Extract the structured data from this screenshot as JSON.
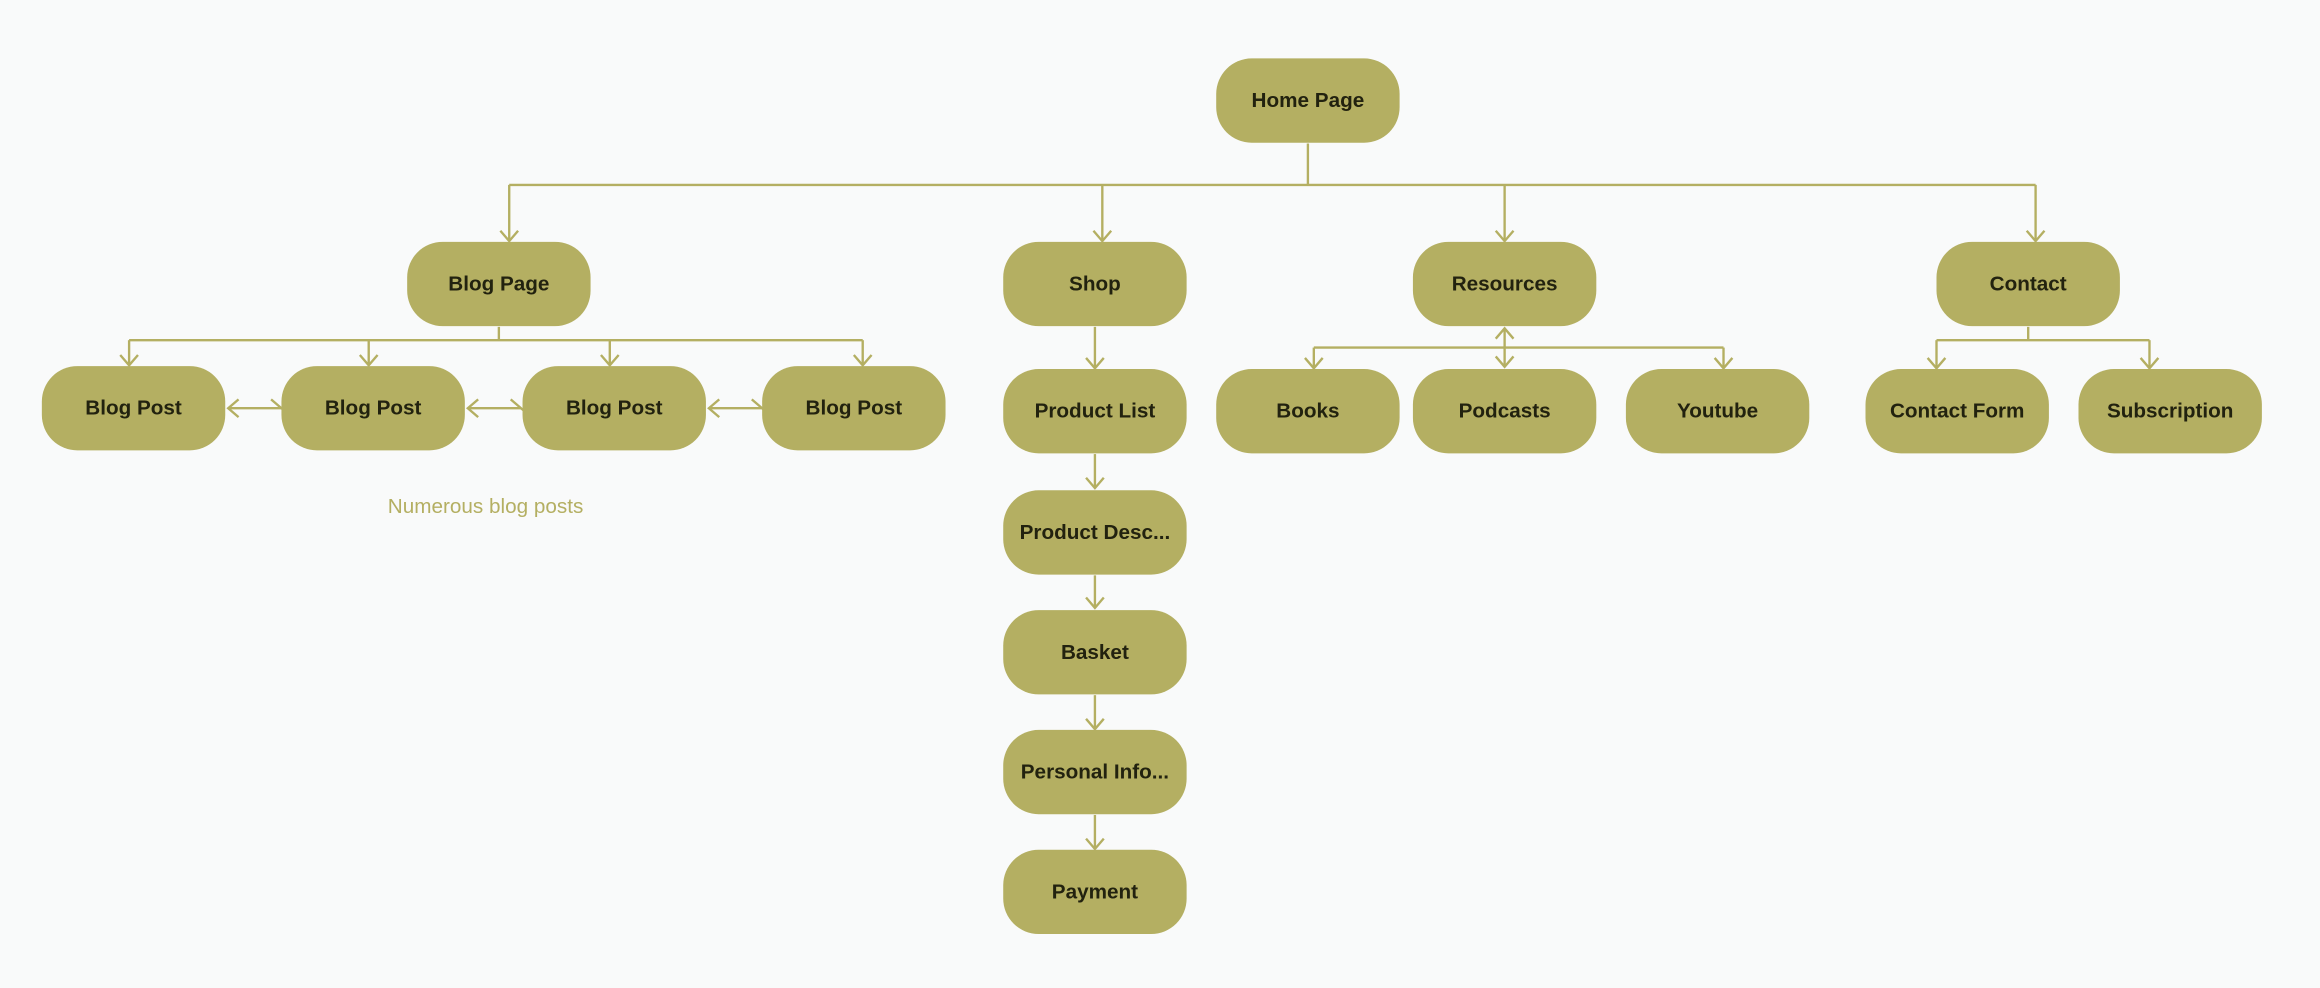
{
  "colors": {
    "node_fill": "#b4af62",
    "node_text": "#22220f",
    "connector": "#b4af62",
    "background": "#f9fafa"
  },
  "nodes": {
    "home": "Home Page",
    "blog_page": "Blog Page",
    "shop": "Shop",
    "resources": "Resources",
    "contact": "Contact",
    "blog_posts": [
      "Blog Post",
      "Blog Post",
      "Blog Post",
      "Blog Post"
    ],
    "shop_flow": [
      "Product List",
      "Product Desc...",
      "Basket",
      "Personal Info...",
      "Payment"
    ],
    "resources_children": [
      "Books",
      "Podcasts",
      "Youtube"
    ],
    "contact_children": [
      "Contact Form",
      "Subscription"
    ]
  },
  "annotations": {
    "blog_note": "Numerous blog posts"
  }
}
